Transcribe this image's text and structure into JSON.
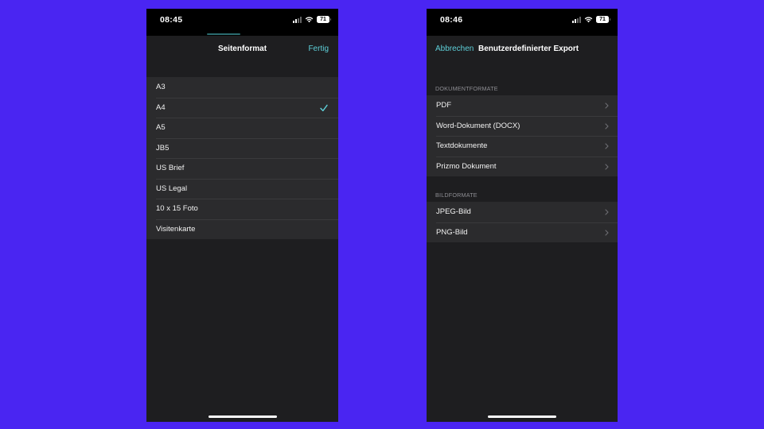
{
  "left_phone": {
    "status": {
      "time": "08:45",
      "battery": "71"
    },
    "nav": {
      "title": "Seitenformat",
      "done_label": "Fertig"
    },
    "items": [
      {
        "label": "A3",
        "selected": false
      },
      {
        "label": "A4",
        "selected": true
      },
      {
        "label": "A5",
        "selected": false
      },
      {
        "label": "JB5",
        "selected": false
      },
      {
        "label": "US Brief",
        "selected": false
      },
      {
        "label": "US Legal",
        "selected": false
      },
      {
        "label": "10 x 15 Foto",
        "selected": false
      },
      {
        "label": "Visitenkarte",
        "selected": false
      }
    ]
  },
  "right_phone": {
    "status": {
      "time": "08:46",
      "battery": "71"
    },
    "nav": {
      "cancel_label": "Abbrechen",
      "title": "Benutzerdefinierter Export"
    },
    "sections": [
      {
        "header": "DOKUMENTFORMATE",
        "items": [
          "PDF",
          "Word-Dokument (DOCX)",
          "Textdokumente",
          "Prizmo Dokument"
        ]
      },
      {
        "header": "BILDFORMATE",
        "items": [
          "JPEG-Bild",
          "PNG-Bild"
        ]
      }
    ]
  },
  "colors": {
    "background": "#4a25f2",
    "accent": "#5ecfd8",
    "cell": "#2b2b2d",
    "sheet": "#1e1e20"
  },
  "icons": {
    "check": "checkmark-icon",
    "chevron": "chevron-right-icon",
    "wifi": "wifi-icon",
    "signal": "cellular-signal-icon",
    "battery": "battery-icon"
  }
}
